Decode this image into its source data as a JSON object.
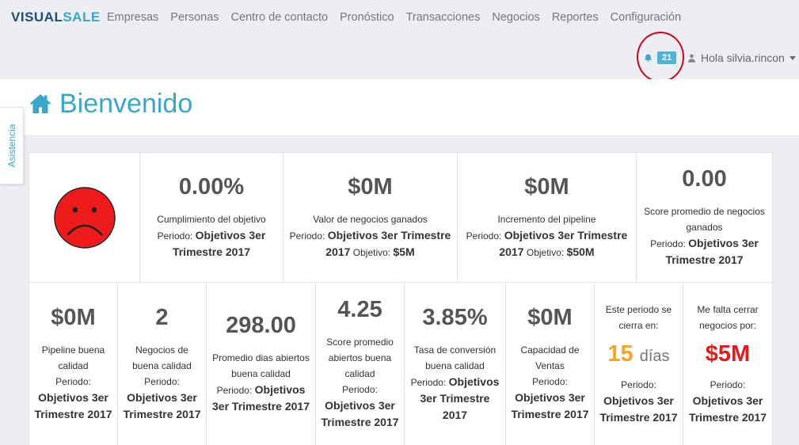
{
  "brand": {
    "part1": "V",
    "part2": "ISUAL",
    "part3": "SALE"
  },
  "nav": [
    "Empresas",
    "Personas",
    "Centro de contacto",
    "Pronóstico",
    "Transacciones",
    "Negocios",
    "Reportes",
    "Configuración"
  ],
  "notifications": {
    "count": "21"
  },
  "user": {
    "greeting": "Hola silvia.rincon"
  },
  "page_title": "Bienvenido",
  "side_tab": "Asistencia",
  "row1": [
    {
      "value": "0.00%",
      "label": "Cumplimiento del objetivo",
      "period_prefix": "Periodo:",
      "period": "Objetivos 3er Trimestre 2017",
      "goal_prefix": "",
      "goal": ""
    },
    {
      "value": "$0M",
      "label": "Valor de negocios ganados",
      "period_prefix": "Periodo:",
      "period": "Objetivos 3er Trimestre 2017",
      "goal_prefix": "Objetivo:",
      "goal": "$5M"
    },
    {
      "value": "$0M",
      "label": "Incremento del pipeline",
      "period_prefix": "Periodo:",
      "period": "Objetivos 3er Trimestre 2017",
      "goal_prefix": "Objetivo:",
      "goal": "$50M"
    },
    {
      "value": "0.00",
      "label": "Score promedio de negocios ganados",
      "period_prefix": "Periodo:",
      "period": "Objetivos 3er Trimestre 2017",
      "goal_prefix": "",
      "goal": ""
    }
  ],
  "row2": [
    {
      "value": "$0M",
      "label": "Pipeline buena calidad",
      "period_prefix": "Periodo:",
      "period": "Objetivos 3er Trimestre 2017"
    },
    {
      "value": "2",
      "label": "Negocios de buena calidad",
      "period_prefix": "Periodo:",
      "period": "Objetivos 3er Trimestre 2017"
    },
    {
      "value": "298.00",
      "label": "Promedio dias abiertos buena calidad",
      "period_prefix": "Periodo:",
      "period": "Objetivos 3er Trimestre 2017"
    },
    {
      "value": "4.25",
      "label": "Score promedio abiertos buena calidad",
      "period_prefix": "Periodo:",
      "period": "Objetivos 3er Trimestre 2017"
    },
    {
      "value": "3.85%",
      "label": "Tasa de conversión buena calidad",
      "period_prefix": "Periodo:",
      "period": "Objetivos 3er Trimestre 2017"
    },
    {
      "value": "$0M",
      "label": "Capacidad de Ventas",
      "period_prefix": "Periodo:",
      "period": "Objetivos 3er Trimestre 2017"
    }
  ],
  "close_period": {
    "label": "Este periodo se cierra en:",
    "value": "15",
    "unit": "días",
    "period_prefix": "Periodo:",
    "period": "Objetivos 3er Trimestre 2017"
  },
  "remaining": {
    "label": "Me falta cerrar negocios por:",
    "value": "$5M",
    "period_prefix": "Periodo:",
    "period": "Objetivos 3er Trimestre 2017"
  },
  "colors": {
    "accent": "#3aa7c9",
    "warning": "#f5a623",
    "danger": "#e21b1b",
    "face": "#ee1b1b"
  },
  "icons": {
    "status": "sad-face-icon",
    "home": "home-icon",
    "bell": "bell-icon",
    "user": "user-icon"
  }
}
